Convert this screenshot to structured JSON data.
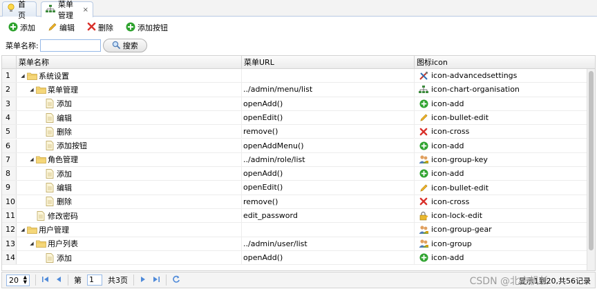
{
  "tabs": [
    {
      "label": "首页",
      "icon": "lightbulb-icon"
    },
    {
      "label": "菜单管理",
      "icon": "org-chart-icon",
      "close": "×"
    }
  ],
  "toolbar": {
    "add": "添加",
    "edit": "编辑",
    "delete": "删除",
    "add_button": "添加按钮"
  },
  "search": {
    "label": "菜单名称:",
    "value": "",
    "placeholder": "",
    "button": "搜索"
  },
  "grid": {
    "columns": [
      "菜单名称",
      "菜单URL",
      "图标icon"
    ],
    "rows": [
      {
        "n": "1",
        "depth": 0,
        "toggle": "◢",
        "folder": true,
        "name": "系统设置",
        "url": "",
        "icon": "icon-advancedsettings",
        "glyph": "tools"
      },
      {
        "n": "2",
        "depth": 1,
        "toggle": "◢",
        "folder": true,
        "name": "菜单管理",
        "url": "../admin/menu/list",
        "icon": "icon-chart-organisation",
        "glyph": "org"
      },
      {
        "n": "3",
        "depth": 2,
        "toggle": "",
        "folder": false,
        "name": "添加",
        "url": "openAdd()",
        "icon": "icon-add",
        "glyph": "add"
      },
      {
        "n": "4",
        "depth": 2,
        "toggle": "",
        "folder": false,
        "name": "编辑",
        "url": "openEdit()",
        "icon": "icon-bullet-edit",
        "glyph": "pencil"
      },
      {
        "n": "5",
        "depth": 2,
        "toggle": "",
        "folder": false,
        "name": "删除",
        "url": "remove()",
        "icon": "icon-cross",
        "glyph": "cross"
      },
      {
        "n": "6",
        "depth": 2,
        "toggle": "",
        "folder": false,
        "name": "添加按钮",
        "url": "openAddMenu()",
        "icon": "icon-add",
        "glyph": "add"
      },
      {
        "n": "7",
        "depth": 1,
        "toggle": "◢",
        "folder": true,
        "name": "角色管理",
        "url": "../admin/role/list",
        "icon": "icon-group-key",
        "glyph": "group"
      },
      {
        "n": "8",
        "depth": 2,
        "toggle": "",
        "folder": false,
        "name": "添加",
        "url": "openAdd()",
        "icon": "icon-add",
        "glyph": "add"
      },
      {
        "n": "9",
        "depth": 2,
        "toggle": "",
        "folder": false,
        "name": "编辑",
        "url": "openEdit()",
        "icon": "icon-bullet-edit",
        "glyph": "pencil"
      },
      {
        "n": "10",
        "depth": 2,
        "toggle": "",
        "folder": false,
        "name": "删除",
        "url": "remove()",
        "icon": "icon-cross",
        "glyph": "cross"
      },
      {
        "n": "11",
        "depth": 1,
        "toggle": "",
        "folder": false,
        "name": "修改密码",
        "url": "edit_password",
        "icon": "icon-lock-edit",
        "glyph": "lock"
      },
      {
        "n": "12",
        "depth": 0,
        "toggle": "◢",
        "folder": true,
        "name": "用户管理",
        "url": "",
        "icon": "icon-group-gear",
        "glyph": "group"
      },
      {
        "n": "13",
        "depth": 1,
        "toggle": "◢",
        "folder": true,
        "name": "用户列表",
        "url": "../admin/user/list",
        "icon": "icon-group",
        "glyph": "group"
      },
      {
        "n": "14",
        "depth": 2,
        "toggle": "",
        "folder": false,
        "name": "添加",
        "url": "openAdd()",
        "icon": "icon-add",
        "glyph": "add"
      }
    ]
  },
  "pager": {
    "page_size": "20",
    "page_prefix": "第",
    "page_current": "1",
    "page_suffix": "共3页",
    "info": "显示1到20,共56记录"
  },
  "watermark": "CSDN @北方帆长",
  "colors": {
    "accent": "#95b8e7",
    "add_green": "#2fa32f",
    "cross_red": "#d9312b"
  }
}
